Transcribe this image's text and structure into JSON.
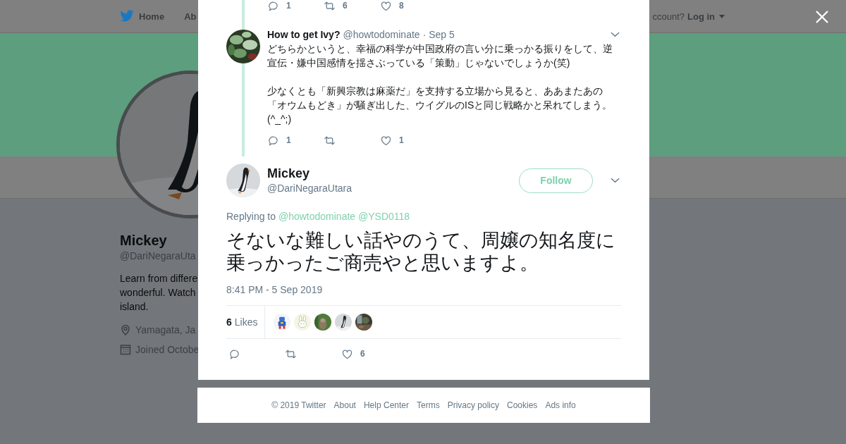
{
  "top_nav": {
    "home_link": "Home",
    "about_link_partial": "Ab",
    "account_prompt_partial": "ccount?",
    "login_link": "Log in"
  },
  "profile": {
    "name": "Mickey",
    "handle_partial": "@DariNegaraUta",
    "bio_lines": [
      "Learn from differe",
      "wonderful. Watch",
      "island."
    ],
    "location_partial": "Yamagata, Ja",
    "joined_partial": "Joined Octobe"
  },
  "dialog": {
    "previous_tweet_actions": [
      {
        "kind": "reply",
        "count": "1"
      },
      {
        "kind": "retweet",
        "count": "6"
      },
      {
        "kind": "like",
        "count": "8"
      }
    ],
    "reply_tweet": {
      "name": "How to get Ivy?",
      "handle": "@howtodominate",
      "date": "· Sep 5",
      "text": "どちらかというと、幸福の科学が中国政府の言い分に乗っかる振りをして、逆宣伝・嫌中国感情を揺さぶっている「策動」じゃないでしょうか(笑)\n\n少なくとも「新興宗教は麻薬だ」を支持する立場から見ると、ああまたあの「オウムもどき」が騒ぎ出した、ウイグルのISと同じ戦略かと呆れてしまう。(^_^;)",
      "actions": [
        {
          "kind": "reply",
          "count": "1"
        },
        {
          "kind": "retweet"
        },
        {
          "kind": "like",
          "count": "1"
        }
      ]
    },
    "main_tweet": {
      "name": "Mickey",
      "handle": "@DariNegaraUtara",
      "follow_button": "Follow",
      "replying_label": "Replying to",
      "replying_to": [
        "@howtodominate",
        "@YSD0118"
      ],
      "text": "そないな難しい話やのうて、周嬢の知名度に乗っかったご商売やと思いますよ。",
      "timestamp": "8:41 PM - 5 Sep 2019",
      "likes_count": "6",
      "likes_label": "Likes",
      "likers": [
        {
          "kind": "picture"
        },
        {
          "kind": "picture"
        },
        {
          "kind": "picture"
        },
        {
          "kind": "picture"
        },
        {
          "kind": "picture"
        }
      ],
      "actions": [
        {
          "kind": "reply"
        },
        {
          "kind": "retweet"
        },
        {
          "kind": "like",
          "count": "6"
        }
      ]
    }
  },
  "footer": {
    "links": [
      "© 2019 Twitter",
      "About",
      "Help Center",
      "Terms",
      "Privacy policy",
      "Cookies",
      "Ads info"
    ]
  }
}
